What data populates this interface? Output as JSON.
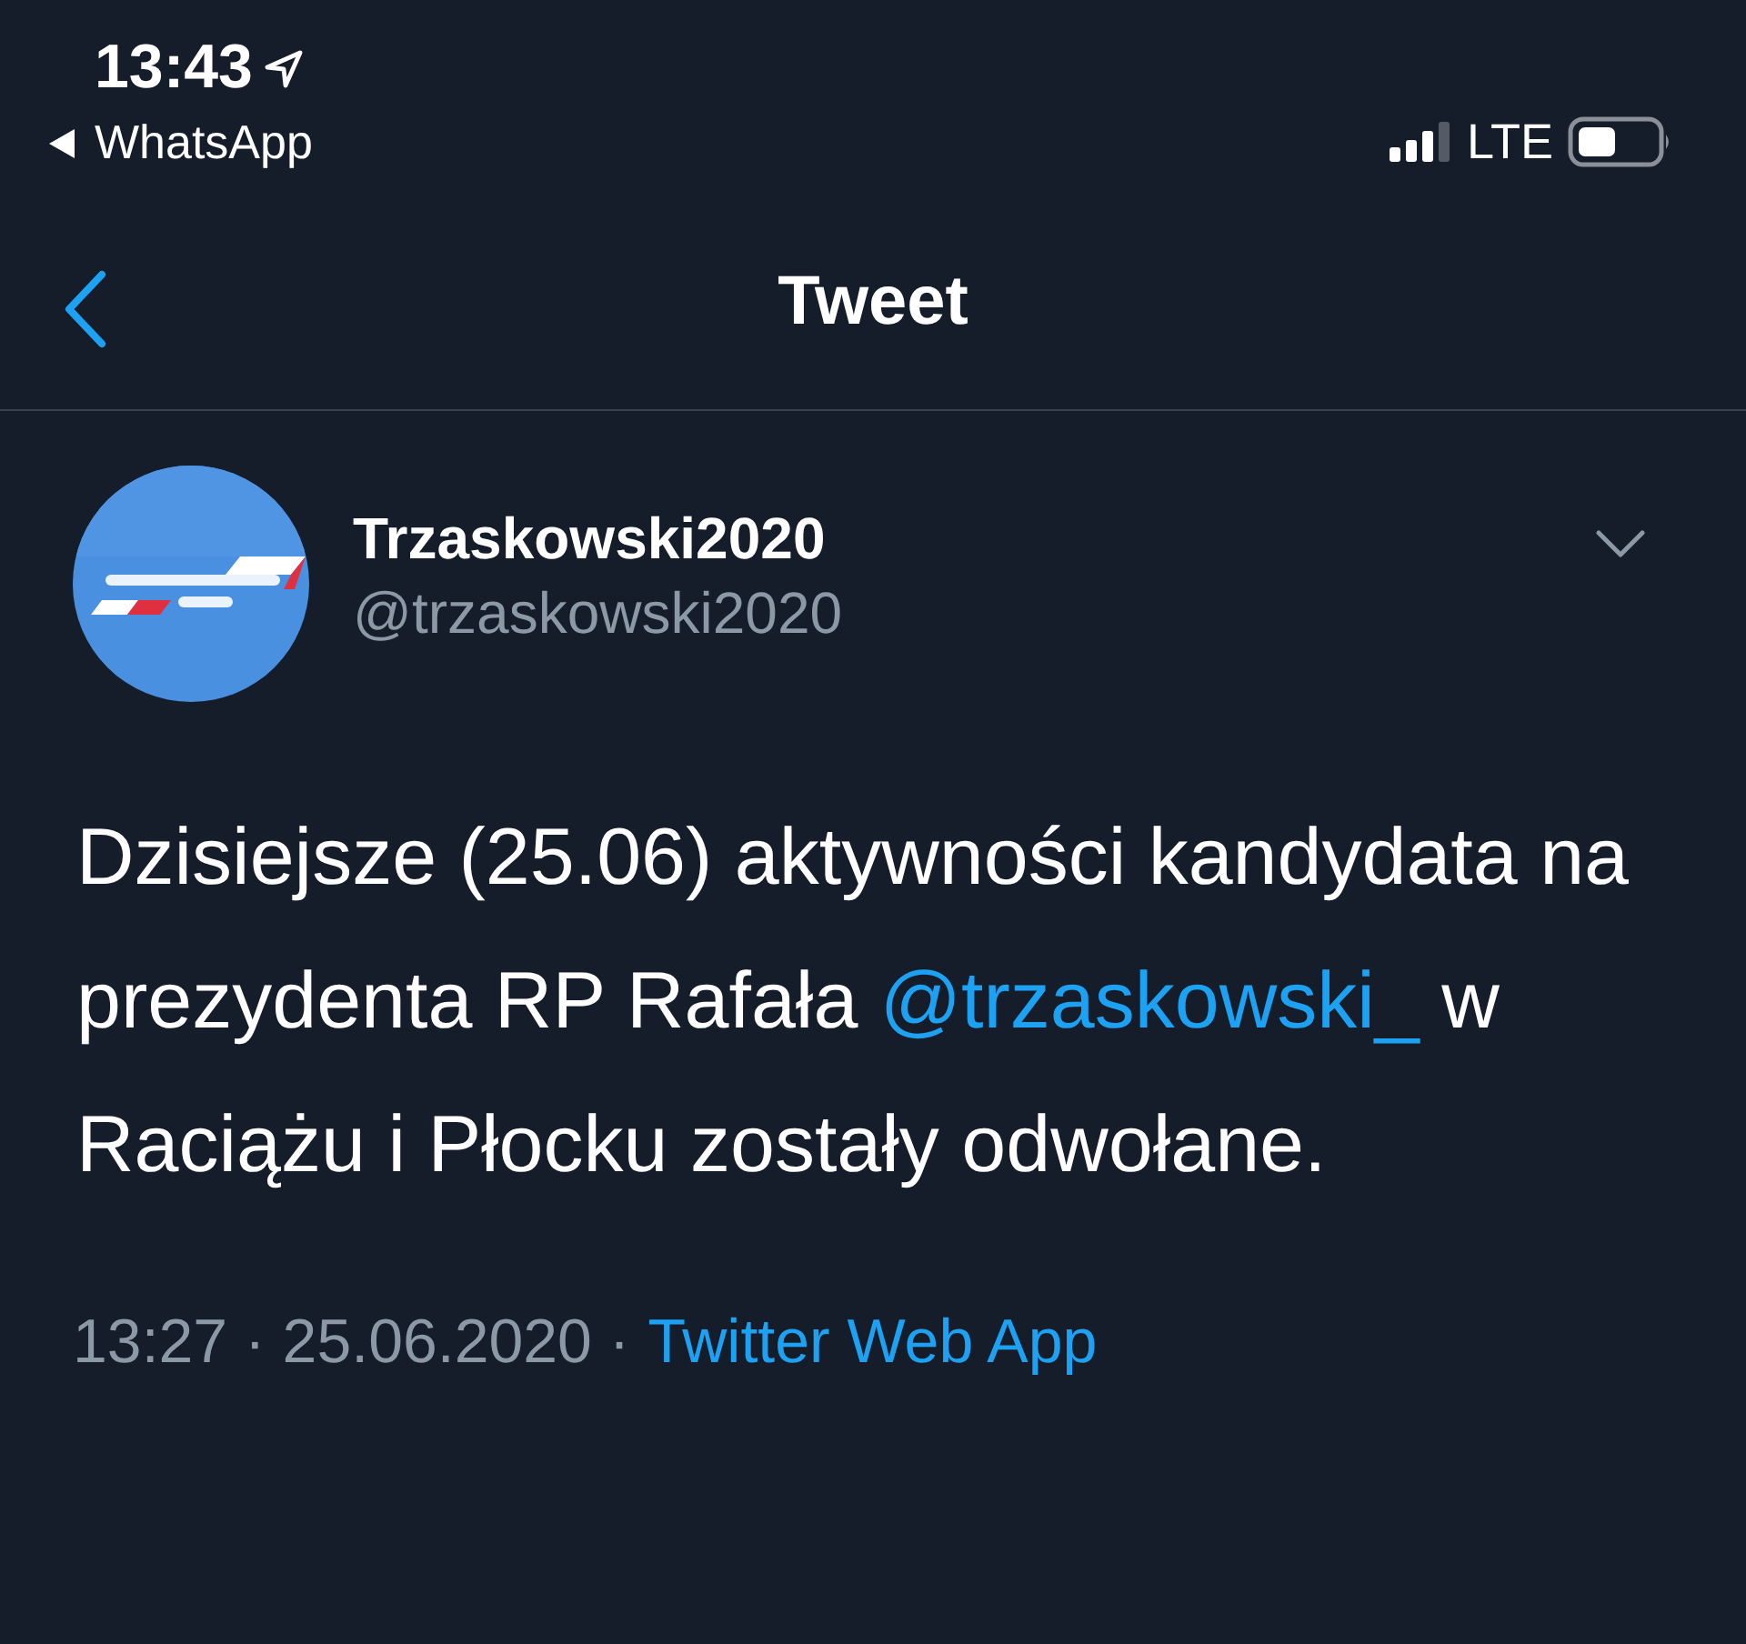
{
  "status_bar": {
    "time": "13:43",
    "back_app": "WhatsApp",
    "network": "LTE"
  },
  "header": {
    "title": "Tweet"
  },
  "tweet": {
    "author": {
      "name": "Trzaskowski2020",
      "handle": "@trzaskowski2020"
    },
    "text": [
      {
        "kind": "text",
        "value": "Dzisiejsze (25.06) aktywności kandydata na prezydenta RP Rafała "
      },
      {
        "kind": "mention",
        "value": "@trzaskowski_"
      },
      {
        "kind": "text",
        "value": " w Raciążu i Płocku zostały odwołane."
      }
    ],
    "timestamp": "13:27 · 25.06.2020 ·",
    "source": "Twitter Web App"
  }
}
